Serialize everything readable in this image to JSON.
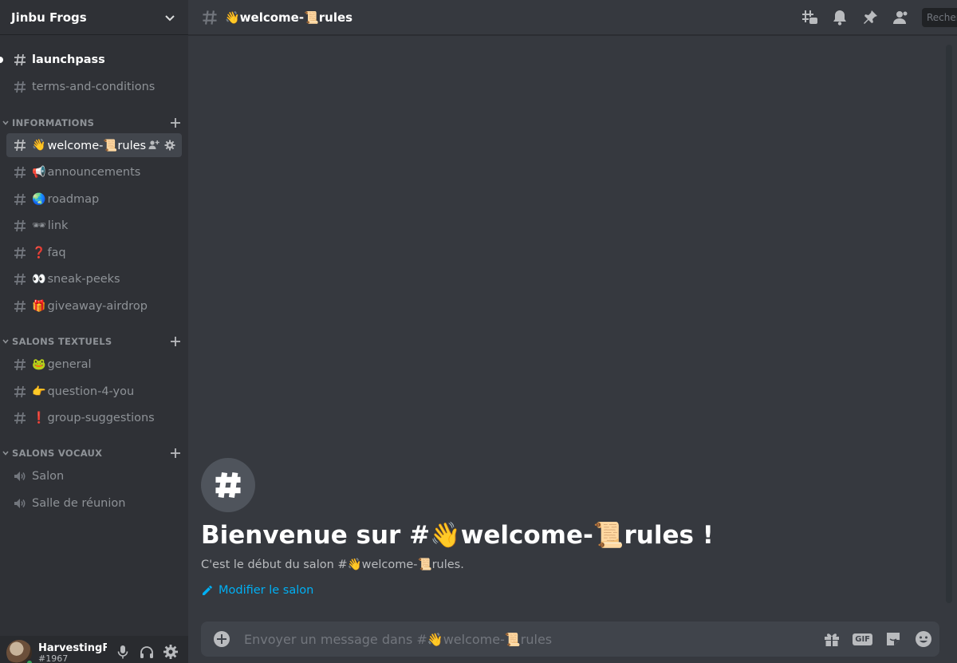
{
  "server": {
    "name": "Jinbu Frogs"
  },
  "sidebar": {
    "top_channels": [
      {
        "name": "launchpass",
        "emoji": ""
      },
      {
        "name": "terms-and-conditions",
        "emoji": ""
      }
    ],
    "categories": [
      {
        "name": "INFORMATIONS",
        "channels": [
          {
            "emoji": "👋",
            "name": "welcome-📜rules"
          },
          {
            "emoji": "📢",
            "name": "announcements"
          },
          {
            "emoji": "🌏",
            "name": "roadmap"
          },
          {
            "emoji": "🕶",
            "name": "link"
          },
          {
            "emoji": "❓",
            "name": "faq"
          },
          {
            "emoji": "👀",
            "name": "sneak-peeks"
          },
          {
            "emoji": "🎁",
            "name": "giveaway-airdrop"
          }
        ]
      },
      {
        "name": "SALONS TEXTUELS",
        "channels": [
          {
            "emoji": "🐸",
            "name": "general"
          },
          {
            "emoji": "👉",
            "name": "question-4-you"
          },
          {
            "emoji": "❗",
            "name": "group-suggestions"
          }
        ]
      },
      {
        "name": "SALONS VOCAUX",
        "channels": [
          {
            "name": "Salon"
          },
          {
            "name": "Salle de réunion"
          }
        ]
      }
    ]
  },
  "user": {
    "name": "HarvestingF...",
    "discriminator": "#1967"
  },
  "header": {
    "channel_name": "👋welcome-📜rules",
    "search_placeholder": "Recherche"
  },
  "welcome": {
    "title": "Bienvenue sur #👋welcome-📜rules !",
    "subtitle": "C'est le début du salon #👋welcome-📜rules.",
    "edit_link": "Modifier le salon"
  },
  "composer": {
    "placeholder": "Envoyer un message dans #👋welcome-📜rules",
    "gif_label": "GIF"
  },
  "colors": {
    "accent_link": "#00b0f4",
    "background": "#36393f",
    "sidebar": "#2f3136",
    "online": "#3ba55d"
  }
}
